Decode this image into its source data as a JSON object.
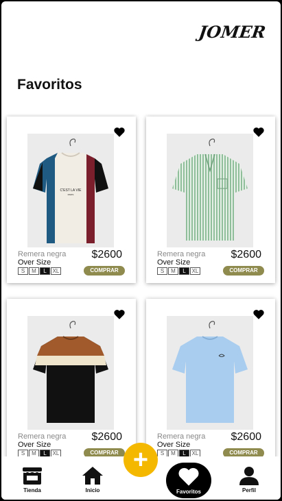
{
  "brand": {
    "logo_text": "JOMER"
  },
  "page": {
    "title": "Favoritos"
  },
  "products": [
    {
      "name": "Remera negra",
      "fit": "Over Size",
      "price": "$2600",
      "sizes": [
        "S",
        "M",
        "L",
        "XL"
      ],
      "selected_size": "L",
      "buy_label": "COMPRAR",
      "favorite": true,
      "shirt": "colorblock-vertical"
    },
    {
      "name": "Remera negra",
      "fit": "Over Size",
      "price": "$2600",
      "sizes": [
        "S",
        "M",
        "L",
        "XL"
      ],
      "selected_size": "L",
      "buy_label": "COMPRAR",
      "favorite": true,
      "shirt": "green-stripes"
    },
    {
      "name": "Remera negra",
      "fit": "Over Size",
      "price": "$2600",
      "sizes": [
        "S",
        "M",
        "L",
        "XL"
      ],
      "selected_size": "L",
      "buy_label": "COMPRAR",
      "favorite": true,
      "shirt": "colorblock-horizontal"
    },
    {
      "name": "Remera negra",
      "fit": "Over Size",
      "price": "$2600",
      "sizes": [
        "S",
        "M",
        "L",
        "XL"
      ],
      "selected_size": "L",
      "buy_label": "COMPRAR",
      "favorite": true,
      "shirt": "light-blue"
    }
  ],
  "fab": {
    "label": "+"
  },
  "nav": {
    "items": [
      {
        "label": "Tienda",
        "icon": "store-icon"
      },
      {
        "label": "Inicio",
        "icon": "home-icon"
      },
      {
        "label": "Favoritos",
        "icon": "heart-icon",
        "active": true
      },
      {
        "label": "Perfil",
        "icon": "user-icon"
      }
    ]
  },
  "colors": {
    "accent": "#f5b800",
    "buy_button": "#8f8a4e",
    "active_nav": "#000000"
  }
}
